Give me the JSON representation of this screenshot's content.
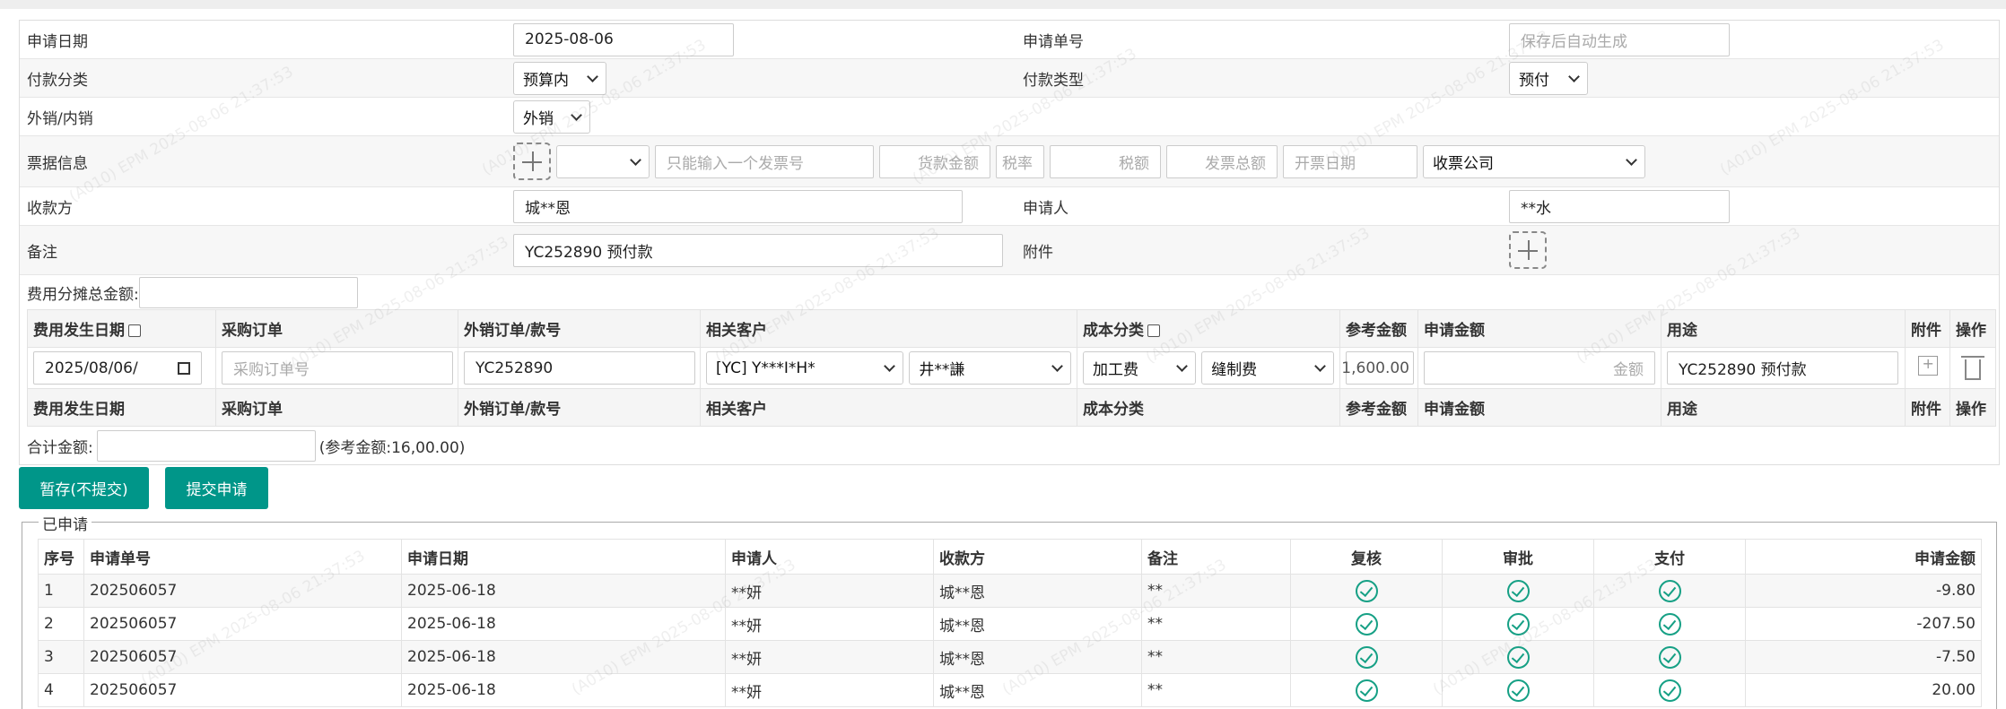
{
  "form": {
    "apply_date_label": "申请日期",
    "apply_date_value": "2025-08-06",
    "apply_no_label": "申请单号",
    "apply_no_placeholder": "保存后自动生成",
    "pay_category_label": "付款分类",
    "pay_category_value": "预算内",
    "pay_type_label": "付款类型",
    "pay_type_value": "预付",
    "sales_label": "外销/内销",
    "sales_value": "外销",
    "invoice_label": "票据信息",
    "invoice_no_placeholder": "只能输入一个发票号",
    "goods_amount_placeholder": "货款金额",
    "tax_rate_placeholder": "税率",
    "tax_amount_placeholder": "税额",
    "invoice_total_placeholder": "发票总额",
    "invoice_date_placeholder": "开票日期",
    "invoice_company_value": "收票公司",
    "payee_label": "收款方",
    "payee_value": "城**恩",
    "applicant_label": "申请人",
    "applicant_value": "**水",
    "remark_label": "备注",
    "remark_value": "YC252890 预付款",
    "attachment_label": "附件",
    "cost_total_label": "费用分摊总金额:"
  },
  "detail": {
    "headers": [
      "费用发生日期",
      "采购订单",
      "外销订单/款号",
      "相关客户",
      "成本分类",
      "参考金额",
      "申请金额",
      "用途",
      "附件",
      "操作"
    ],
    "row": {
      "date": "2025/08/06/",
      "po_placeholder": "采购订单号",
      "order_no": "YC252890",
      "customer": "[YC] Y***I*H*",
      "contact": "井**謙",
      "cost_class": "加工费",
      "cost_sub": "缝制费",
      "ref_amount": "1,600.00",
      "amount_placeholder": "金额",
      "purpose": "YC252890 预付款"
    },
    "total_label": "合计金额:",
    "ref_total": "(参考金额:16,00.00)"
  },
  "buttons": {
    "save_label": "暂存(不提交)",
    "submit_label": "提交申请"
  },
  "history": {
    "legend": "已申请",
    "headers": [
      "序号",
      "申请单号",
      "申请日期",
      "申请人",
      "收款方",
      "备注",
      "复核",
      "审批",
      "支付",
      "申请金额"
    ],
    "rows": [
      {
        "idx": "1",
        "no": "202506057",
        "date": "2025-06-18",
        "applicant": "**妍",
        "payee": "城**恩",
        "remark": "**",
        "amount": "-9.80"
      },
      {
        "idx": "2",
        "no": "202506057",
        "date": "2025-06-18",
        "applicant": "**妍",
        "payee": "城**恩",
        "remark": "**",
        "amount": "-207.50"
      },
      {
        "idx": "3",
        "no": "202506057",
        "date": "2025-06-18",
        "applicant": "**妍",
        "payee": "城**恩",
        "remark": "**",
        "amount": "-7.50"
      },
      {
        "idx": "4",
        "no": "202506057",
        "date": "2025-06-18",
        "applicant": "**妍",
        "payee": "城**恩",
        "remark": "**",
        "amount": "20.00"
      }
    ]
  },
  "watermark": "(A010) EPM  2025-08-06 21:37:53",
  "colors": {
    "primary": "#009689",
    "check": "#16a085"
  }
}
